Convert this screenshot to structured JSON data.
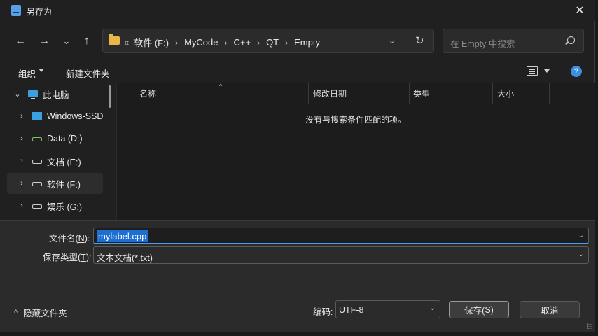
{
  "window": {
    "title": "另存为",
    "close_label": "✕"
  },
  "navigation": {
    "back": "←",
    "forward": "→",
    "recent": "⌄",
    "up": "↑",
    "breadcrumb": {
      "lead": "«",
      "items": [
        "软件 (F:)",
        "MyCode",
        "C++",
        "QT",
        "Empty"
      ],
      "separator": "›"
    },
    "address_dropdown": "⌄",
    "refresh": "↻",
    "search_placeholder": "在 Empty 中搜索"
  },
  "commands": {
    "organize": "组织",
    "new_folder": "新建文件夹",
    "help": "?"
  },
  "sidebar": {
    "items": [
      {
        "label": "此电脑",
        "chevron": "⌄",
        "icon": "pc-icon"
      },
      {
        "label": "Windows-SSD",
        "chevron": "›",
        "icon": "windows-drive-icon"
      },
      {
        "label": "Data (D:)",
        "chevron": "›",
        "icon": "drive-icon"
      },
      {
        "label": "文档 (E:)",
        "chevron": "›",
        "icon": "drive-icon"
      },
      {
        "label": "软件 (F:)",
        "chevron": "›",
        "icon": "drive-icon",
        "selected": true
      },
      {
        "label": "娱乐 (G:)",
        "chevron": "›",
        "icon": "drive-icon"
      }
    ]
  },
  "file_list": {
    "columns": [
      "名称",
      "修改日期",
      "类型",
      "大小"
    ],
    "sort_caret": "^",
    "empty_message": "没有与搜索条件匹配的项。"
  },
  "form": {
    "filename_label": "文件名(",
    "filename_key": "N",
    "filename_label_end": "):",
    "filename_value": "mylabel.cpp",
    "type_label": "保存类型(",
    "type_key": "T",
    "type_label_end": "):",
    "type_value": "文本文档(*.txt)",
    "dropdown_chevron": "⌄",
    "hide_folders": "隐藏文件夹",
    "hide_folders_chevron": "^",
    "encoding_label": "编码:",
    "encoding_value": "UTF-8",
    "save_label": "保存(",
    "save_key": "S",
    "save_label_end": ")",
    "cancel_label": "取消"
  },
  "colors": {
    "accent": "#1e6fd0",
    "folder": "#e9b64a",
    "help": "#3d8ee0"
  }
}
